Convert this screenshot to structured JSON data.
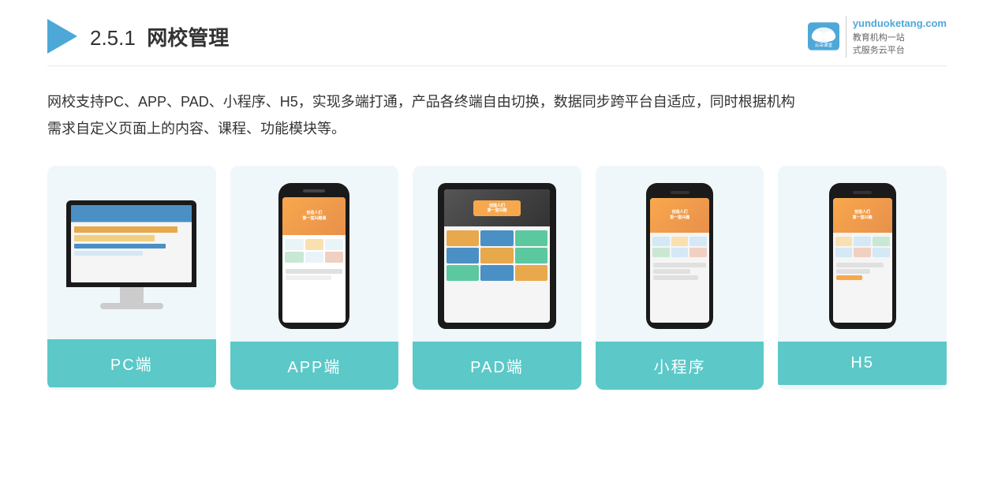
{
  "header": {
    "section_number": "2.5.1",
    "title": "网校管理",
    "logo_url": "yunduoketang.com",
    "logo_tagline_1": "教育机构一站",
    "logo_tagline_2": "式服务云平台"
  },
  "description": {
    "line1": "网校支持PC、APP、PAD、小程序、H5，实现多端打通，产品各终端自由切换，数据同步跨平台自适应，同时根据机构",
    "line2": "需求自定义页面上的内容、课程、功能模块等。"
  },
  "cards": [
    {
      "id": "pc",
      "label": "PC端"
    },
    {
      "id": "app",
      "label": "APP端"
    },
    {
      "id": "pad",
      "label": "PAD端"
    },
    {
      "id": "miniapp",
      "label": "小程序"
    },
    {
      "id": "h5",
      "label": "H5"
    }
  ]
}
